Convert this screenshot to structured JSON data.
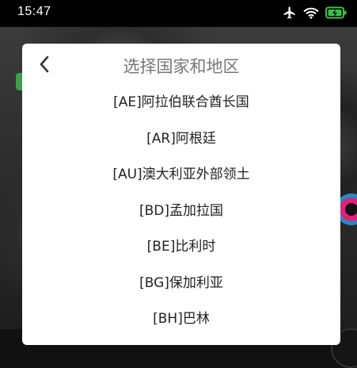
{
  "status_bar": {
    "time": "15:47"
  },
  "dialog": {
    "title": "选择国家和地区",
    "items": [
      "[AE]阿拉伯联合酋长国",
      "[AR]阿根廷",
      "[AU]澳大利亚外部领土",
      "[BD]孟加拉国",
      "[BE]比利时",
      "[BG]保加利亚",
      "[BH]巴林"
    ]
  },
  "colors": {
    "battery_accent": "#35c24a",
    "title_gray": "#777777"
  },
  "icons": [
    "airplane-icon",
    "wifi-icon",
    "battery-charging-icon",
    "back-chevron-icon"
  ]
}
